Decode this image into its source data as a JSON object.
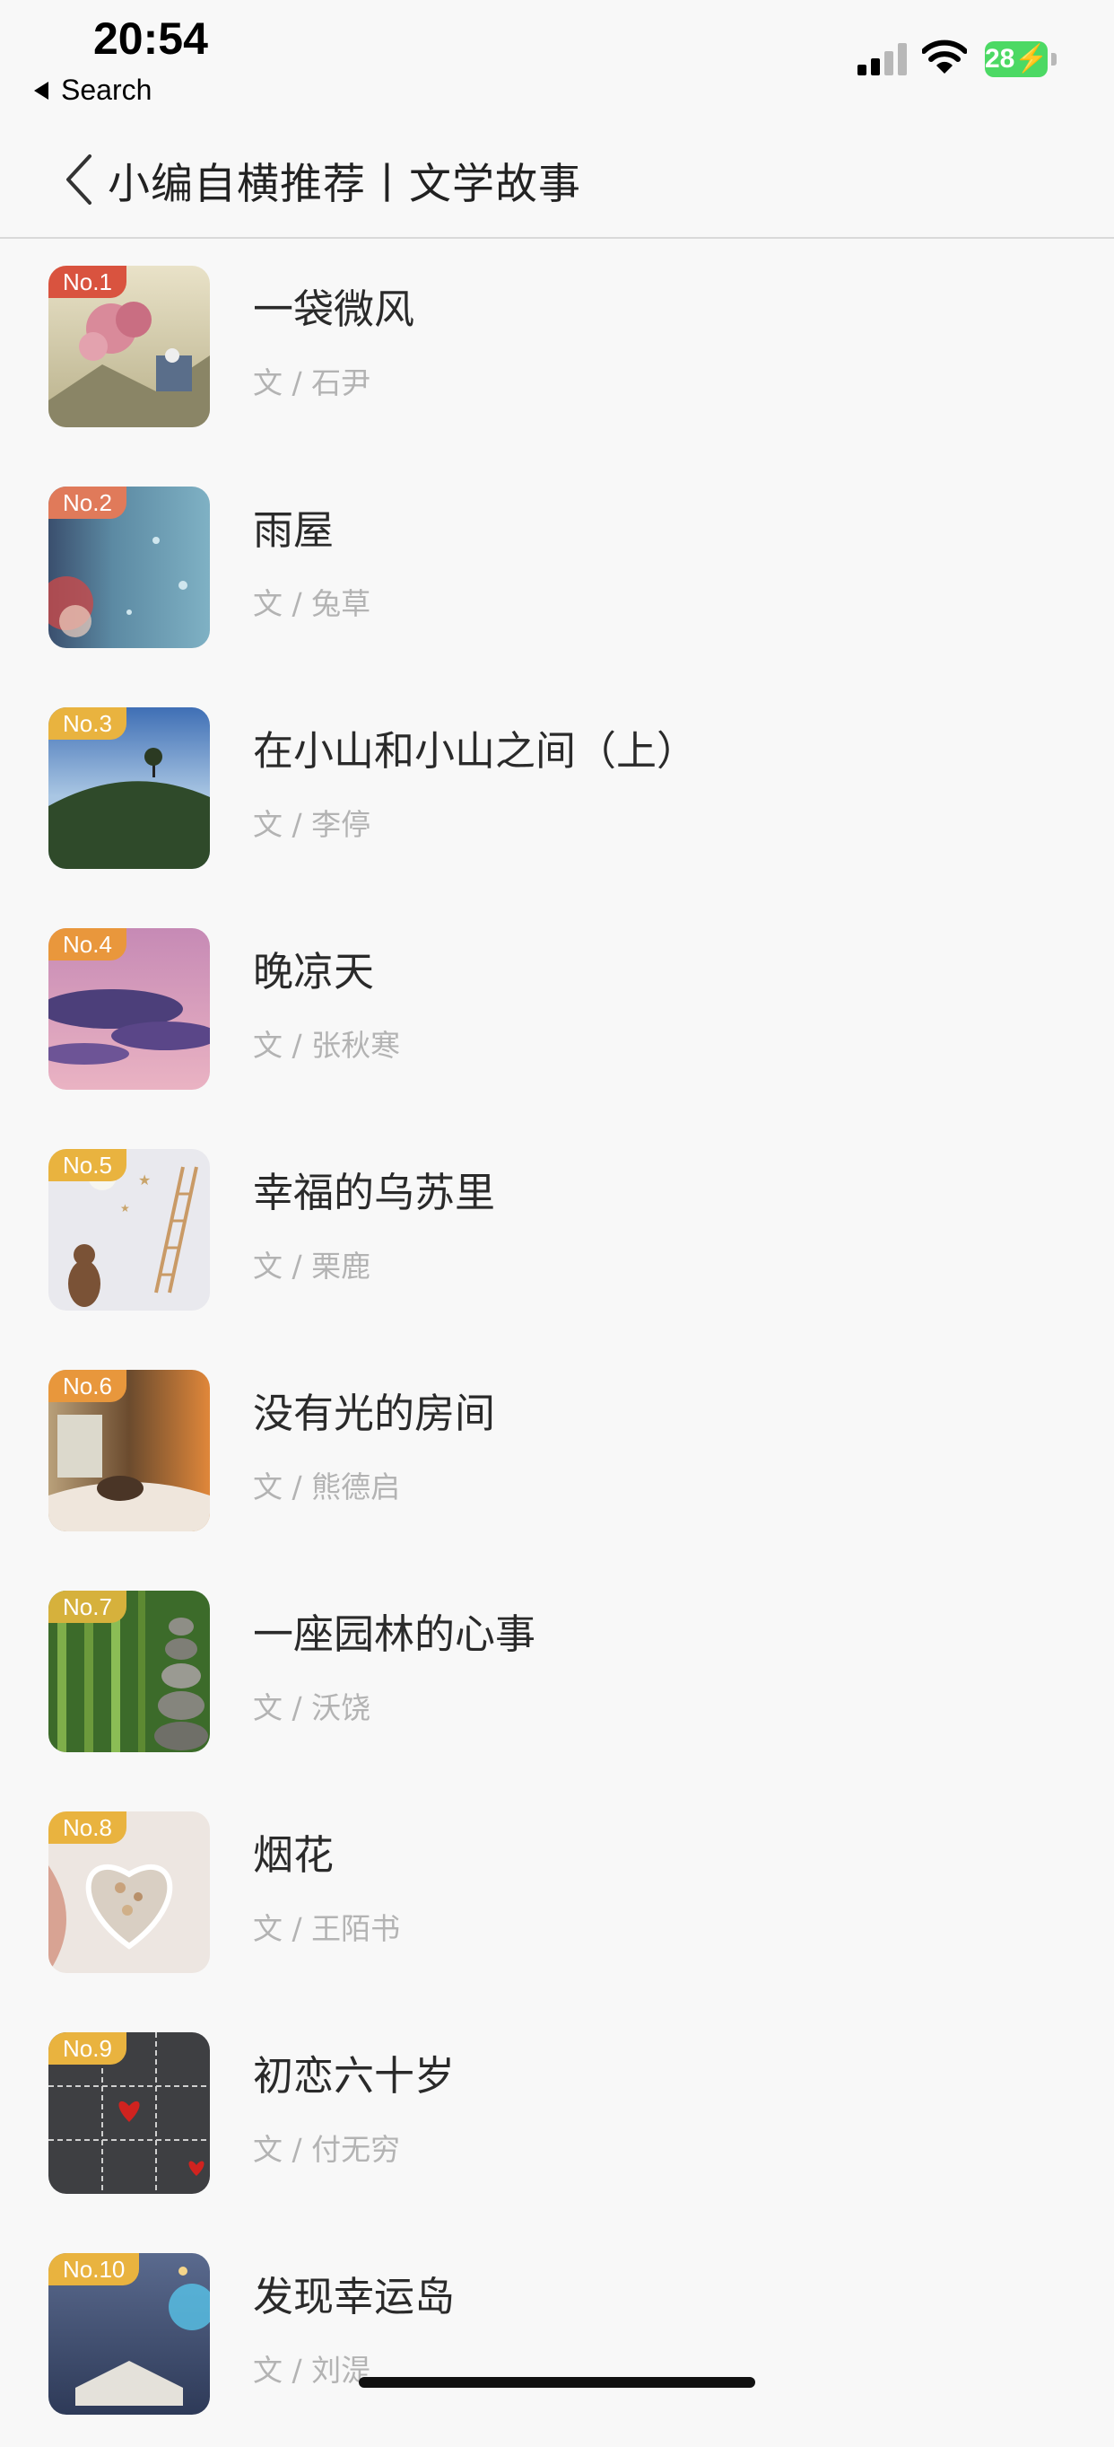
{
  "status_bar": {
    "time": "20:54",
    "back_app_label": "Search",
    "battery_level": "28",
    "icons": [
      "signal-icon",
      "wifi-icon",
      "battery-charging-icon"
    ]
  },
  "nav": {
    "back_icon": "chevron-left-icon",
    "title": "小编自横推荐丨文学故事"
  },
  "colors": {
    "badge_red": "#d9533f",
    "badge_yellow": "#e9b33f",
    "badge_orange": "#e8973c"
  },
  "articles": [
    {
      "rank": "No.1",
      "title": "一袋微风",
      "author": "文 / 石尹",
      "badge_color": "#d9533f"
    },
    {
      "rank": "No.2",
      "title": "雨屋",
      "author": "文 / 兔草",
      "badge_color": "#e07a5a"
    },
    {
      "rank": "No.3",
      "title": "在小山和小山之间（上）",
      "author": "文 / 李停",
      "badge_color": "#e9b33f"
    },
    {
      "rank": "No.4",
      "title": "晚凉天",
      "author": "文 / 张秋寒",
      "badge_color": "#e9b33f"
    },
    {
      "rank": "No.5",
      "title": "幸福的乌苏里",
      "author": "文 / 栗鹿",
      "badge_color": "#e9b33f"
    },
    {
      "rank": "No.6",
      "title": "没有光的房间",
      "author": "文 / 熊德启",
      "badge_color": "#e9b33f"
    },
    {
      "rank": "No.7",
      "title": "一座园林的心事",
      "author": "文 / 沃饶",
      "badge_color": "#e9b33f"
    },
    {
      "rank": "No.8",
      "title": "烟花",
      "author": "文 / 王陌书",
      "badge_color": "#e9b33f"
    },
    {
      "rank": "No.9",
      "title": "初恋六十岁",
      "author": "文 / 付无穷",
      "badge_color": "#e9b33f"
    },
    {
      "rank": "No.10",
      "title": "发现幸运岛",
      "author": "文 / 刘湜",
      "badge_color": "#e9b33f"
    }
  ]
}
